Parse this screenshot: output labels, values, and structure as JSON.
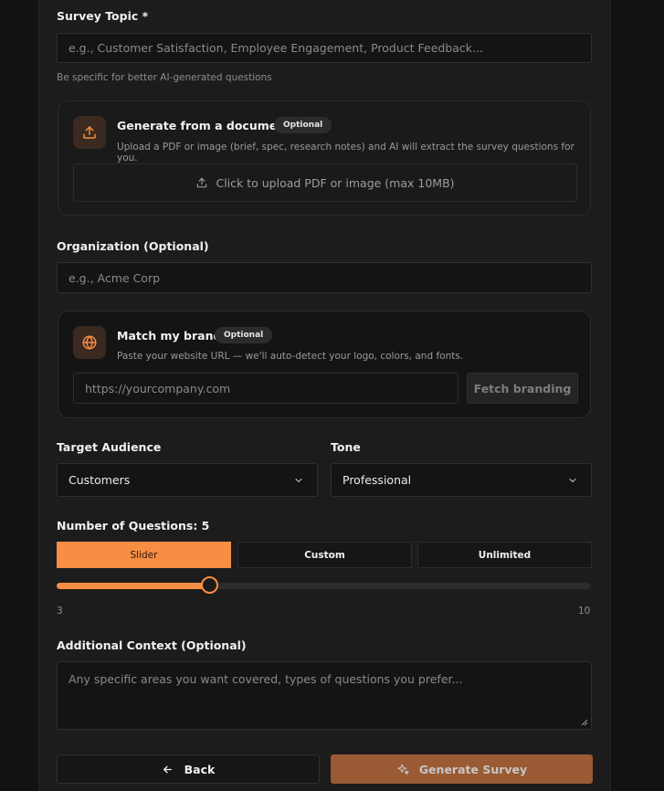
{
  "topic": {
    "label": "Survey Topic *",
    "placeholder": "e.g., Customer Satisfaction, Employee Engagement, Product Feedback...",
    "hint": "Be specific for better AI-generated questions"
  },
  "document_card": {
    "title": "Generate from a document",
    "badge": "Optional",
    "description": "Upload a PDF or image (brief, spec, research notes) and AI will extract the survey questions for you.",
    "upload_label": "Click to upload PDF or image (max 10MB)"
  },
  "organization": {
    "label": "Organization (Optional)",
    "placeholder": "e.g., Acme Corp"
  },
  "brand_card": {
    "title": "Match my brand",
    "badge": "Optional",
    "description": "Paste your website URL — we'll auto-detect your logo, colors, and fonts.",
    "url_placeholder": "https://yourcompany.com",
    "fetch_label": "Fetch branding"
  },
  "audience": {
    "label": "Target Audience",
    "value": "Customers"
  },
  "tone": {
    "label": "Tone",
    "value": "Professional"
  },
  "questions": {
    "label": "Number of Questions: 5",
    "modes": [
      "Slider",
      "Custom",
      "Unlimited"
    ],
    "active_mode": "Slider",
    "min_label": "3",
    "max_label": "10",
    "min": 3,
    "max": 10,
    "value": 5
  },
  "context": {
    "label": "Additional Context (Optional)",
    "placeholder": "Any specific areas you want covered, types of questions you prefer..."
  },
  "actions": {
    "back_label": "Back",
    "generate_label": "Generate Survey"
  },
  "colors": {
    "accent": "#f88d44",
    "accent_muted": "#9a5a33"
  }
}
